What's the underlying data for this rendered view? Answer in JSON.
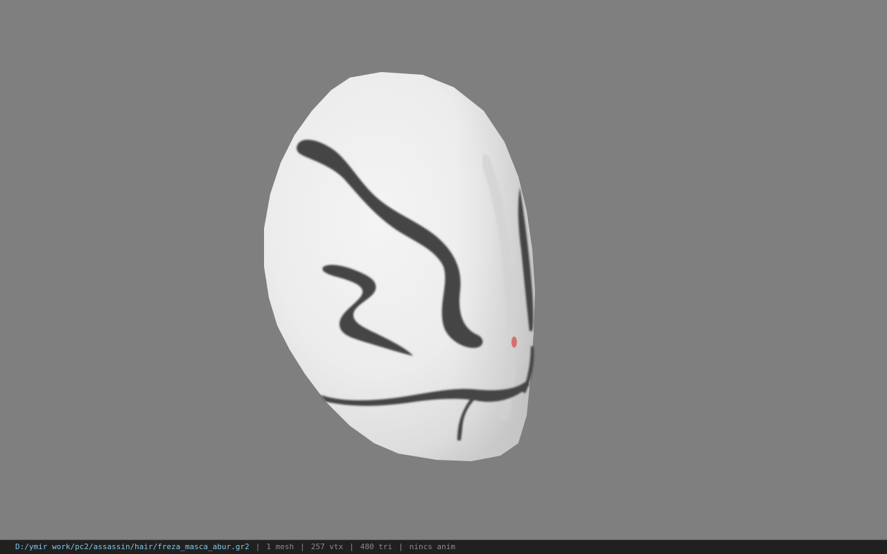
{
  "viewer": {
    "background_color": "#7f7f7f",
    "model_name": "mask-model"
  },
  "status_bar": {
    "file_path": "D:/ymir work/pc2/assassin/hair/freza_masca_abur.gr2",
    "separator": "|",
    "mesh_count": "1 mesh",
    "vertex_count": "257 vtx",
    "triangle_count": "480 tri",
    "animation_status": "nincs anim",
    "colors": {
      "background": "#202020",
      "path_text": "#7fc7e6",
      "stat_text": "#8a8a8a"
    }
  }
}
